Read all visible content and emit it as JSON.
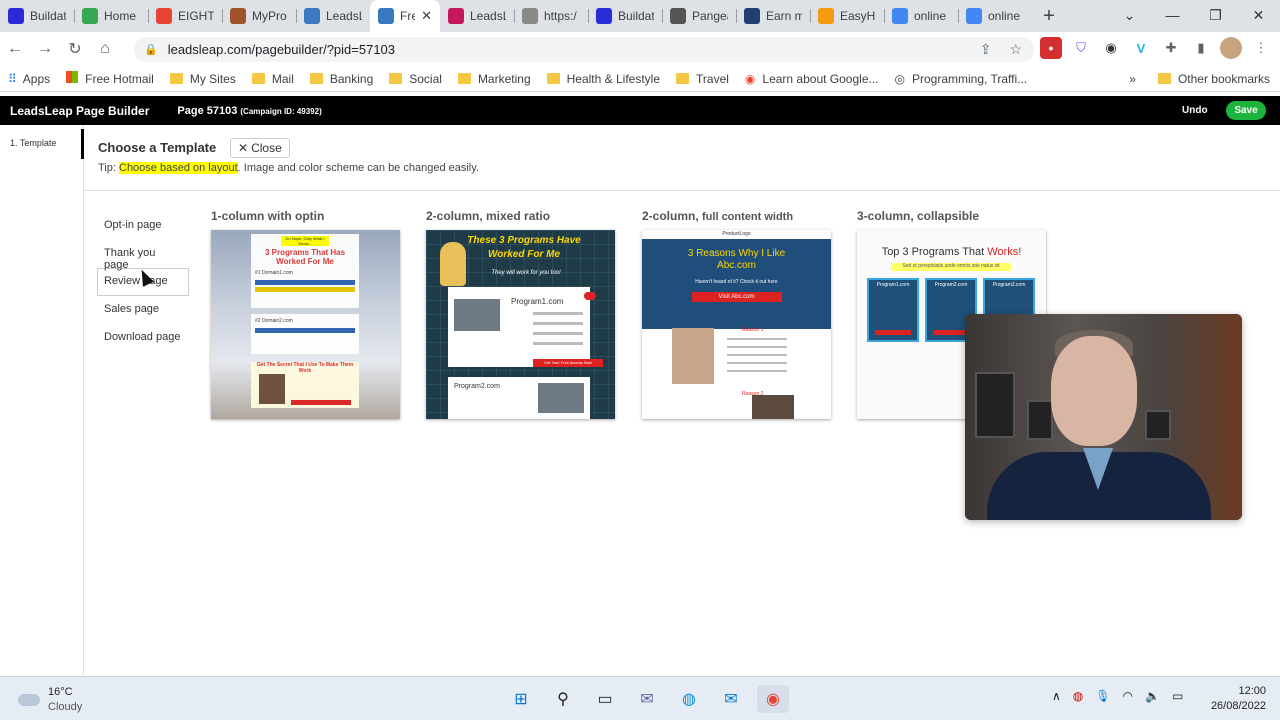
{
  "browser": {
    "tabs": [
      {
        "title": "Buildat",
        "icon": "b-logo-icon",
        "color": "#2b2bd9"
      },
      {
        "title": "Home",
        "icon": "home-logo-icon",
        "color": "#34a853"
      },
      {
        "title": "EIGHT",
        "icon": "gmail-icon",
        "color": "#ea4335"
      },
      {
        "title": "MyPro",
        "icon": "image-icon",
        "color": "#a0522d"
      },
      {
        "title": "LeadsL",
        "icon": "leadsleap-icon",
        "color": "#3b78c2"
      },
      {
        "title": "Fre",
        "icon": "leadsleap-icon",
        "color": "#3b78c2",
        "active": true
      },
      {
        "title": "LeadsL",
        "icon": "circle-logo-icon",
        "color": "#c2185b"
      },
      {
        "title": "https:/",
        "icon": "loading-icon",
        "color": "#888888"
      },
      {
        "title": "Buildat",
        "icon": "b-logo-icon",
        "color": "#2b2bd9"
      },
      {
        "title": "Pangea",
        "icon": "globe-icon",
        "color": "#555555"
      },
      {
        "title": "Earn m",
        "icon": "e-logo-icon",
        "color": "#1f3f6e"
      },
      {
        "title": "EasyHi",
        "icon": "flame-icon",
        "color": "#f39c12"
      },
      {
        "title": "online",
        "icon": "google-icon",
        "color": "#4285f4"
      },
      {
        "title": "online",
        "icon": "google-icon",
        "color": "#4285f4"
      }
    ],
    "url": "leadsleap.com/pagebuilder/?pid=57103",
    "bookmarks": [
      {
        "label": "Apps",
        "type": "apps"
      },
      {
        "label": "Free Hotmail",
        "type": "ms"
      },
      {
        "label": "My Sites",
        "type": "folder"
      },
      {
        "label": "Mail",
        "type": "folder"
      },
      {
        "label": "Banking",
        "type": "folder"
      },
      {
        "label": "Social",
        "type": "folder"
      },
      {
        "label": "Marketing",
        "type": "folder"
      },
      {
        "label": "Health & Lifestyle",
        "type": "folder"
      },
      {
        "label": "Travel",
        "type": "folder"
      },
      {
        "label": "Learn about Google...",
        "type": "google"
      },
      {
        "label": "Programming, Traffi...",
        "type": "globe"
      }
    ],
    "more": "»",
    "other_bookmarks": "Other bookmarks"
  },
  "app": {
    "brand": "LeadsLeap Page Builder",
    "page": "Page 57103",
    "campaign": "(Campaign ID: 49392)",
    "undo": "Undo",
    "save": "Save",
    "step": "1. Template",
    "heading": "Choose a Template",
    "close": "Close",
    "tip_prefix": "Tip: ",
    "tip_highlight": "Choose based on layout",
    "tip_rest": ". Image and color scheme can be changed easily.",
    "categories": [
      "Opt-in page",
      "Thank you page",
      "Review page",
      "Sales page",
      "Download page"
    ],
    "selected_category": 2,
    "templates": [
      {
        "title": "1-column with optin",
        "suffix": ""
      },
      {
        "title": "2-column, mixed ratio",
        "suffix": ""
      },
      {
        "title": "2-column, ",
        "suffix": "full content width"
      },
      {
        "title": "3-column, collapsible",
        "suffix": ""
      }
    ],
    "thumb1": {
      "badge": "Do Nope, Only What I Know...",
      "title": "3 Programs That Has Worked For Me",
      "domain1": "#1 Domain1.com",
      "domain2": "#2 Domain2.com",
      "cta": "Get The Secret That I Use To Make Them Work"
    },
    "thumb2": {
      "title": "These 3 Programs Have Worked For Me",
      "sub": "They will work for you too!",
      "p1": "Program1.com",
      "p2": "Program2.com",
      "cta": "Get Your Free Access Now"
    },
    "thumb3": {
      "logo": "ProductLogo",
      "title": "3 Reasons Why I Like Abc.com",
      "sub": "Haven't heard of it? Check it out here",
      "cta": "Visit Abc.com",
      "r1": "Reason 1",
      "r2": "Reason 2"
    },
    "thumb4": {
      "title_a": "Top 3 Programs That ",
      "title_b": "Works!",
      "sub": "Sed ut perspiciatis unde omnis iste natus sit",
      "cols": [
        "Program1.com",
        "Program2.com",
        "Program3.com"
      ]
    }
  },
  "taskbar": {
    "temp": "16°C",
    "weather": "Cloudy",
    "time": "12:00",
    "date": "26/08/2022"
  }
}
